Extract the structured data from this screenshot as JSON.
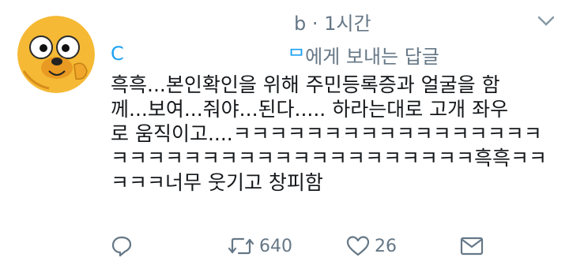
{
  "tweet": {
    "meta": "b · 1시간",
    "reply_prefix": "C",
    "reply_handle_tail": "ᄆ",
    "reply_to_text": "에게 보내는 답글",
    "body_lines": [
      "흑흑...본인확인을 위해 주민등록증과 얼굴을 함",
      "께...보여...줘야...된다..... 하라는대로 고개 좌우",
      "로 움직이고....ㅋㅋㅋㅋㅋㅋㅋㅋㅋㅋㅋㅋㅋㅋㅋㅋㅋ",
      "ㅋㅋㅋㅋㅋㅋㅋㅋㅋㅋㅋㅋㅋㅋㅋㅋㅋㅋㅋㅋ흑흑ㅋㅋ",
      "ㅋㅋㅋ너무 웃기고 창피함"
    ],
    "actions": {
      "reply_icon": "reply-icon",
      "retweet_icon": "retweet-icon",
      "retweet_count": "640",
      "like_icon": "heart-icon",
      "like_count": "26",
      "dm_icon": "envelope-icon"
    },
    "colors": {
      "text": "#14171a",
      "muted": "#657786",
      "link": "#1da1f2",
      "avatar_bg": "#f5b935"
    }
  }
}
